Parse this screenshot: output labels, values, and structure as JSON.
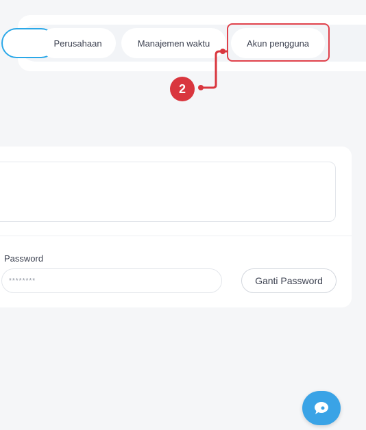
{
  "tabs": [
    {
      "label": "Perusahaan"
    },
    {
      "label": "Manajemen waktu"
    },
    {
      "label": "Akun pengguna"
    }
  ],
  "callout": {
    "step": "2"
  },
  "account": {
    "password_label": "Password",
    "password_value": "********",
    "change_password_label": "Ganti Password"
  },
  "colors": {
    "highlight": "#e0414b",
    "badge": "#d9363e",
    "accent": "#3aa3e6"
  },
  "icons": {
    "chat": "chat-bubble-icon"
  }
}
